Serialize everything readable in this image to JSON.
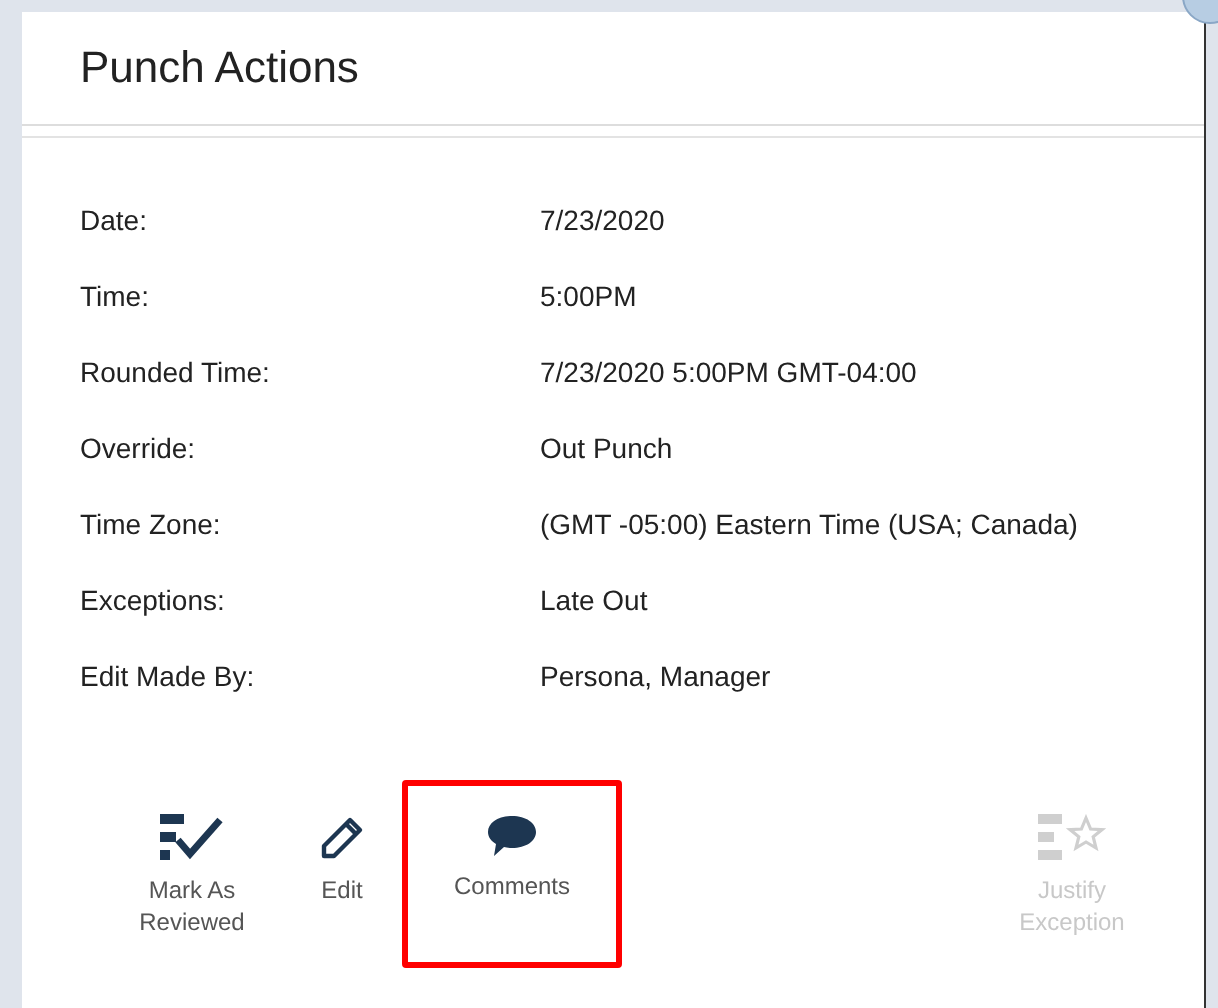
{
  "dialog": {
    "title": "Punch Actions"
  },
  "details": [
    {
      "label": "Date:",
      "value": "7/23/2020"
    },
    {
      "label": "Time:",
      "value": "5:00PM"
    },
    {
      "label": "Rounded Time:",
      "value": "7/23/2020 5:00PM GMT-04:00"
    },
    {
      "label": "Override:",
      "value": "Out Punch"
    },
    {
      "label": "Time Zone:",
      "value": "(GMT -05:00) Eastern Time (USA; Canada)"
    },
    {
      "label": "Exceptions:",
      "value": "Late Out"
    },
    {
      "label": "Edit Made By:",
      "value": "Persona, Manager"
    }
  ],
  "actions": [
    {
      "kind": "review",
      "label": "Mark As Reviewed",
      "disabled": false,
      "highlighted": false
    },
    {
      "kind": "edit",
      "label": "Edit",
      "disabled": false,
      "highlighted": false
    },
    {
      "kind": "comments",
      "label": "Comments",
      "disabled": false,
      "highlighted": true
    },
    {
      "kind": "justify",
      "label": "Justify Exception",
      "disabled": true,
      "highlighted": false
    }
  ]
}
